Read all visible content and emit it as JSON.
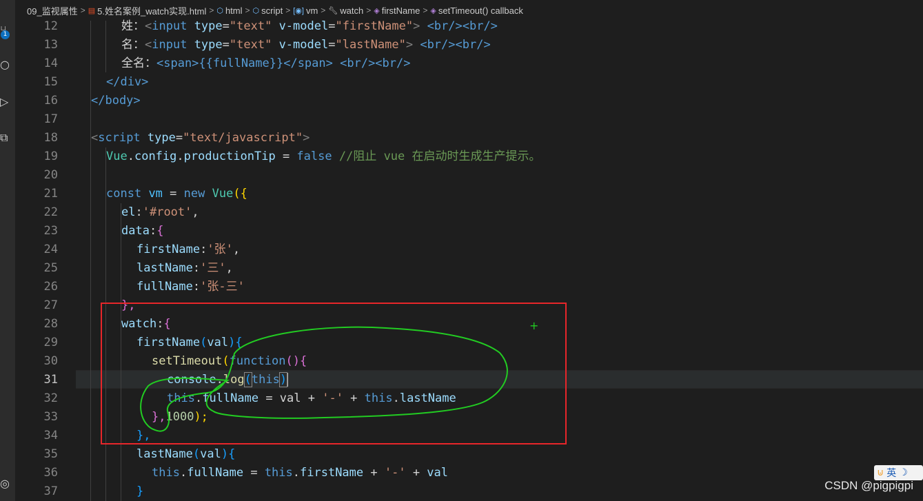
{
  "breadcrumb": {
    "folder": "09_监视属性",
    "file": "5.姓名案例_watch实现.html",
    "items": [
      "html",
      "script",
      "vm",
      "watch",
      "firstName",
      "setTimeout() callback"
    ]
  },
  "activity": {
    "badge_count": "1"
  },
  "gutter": {
    "line_numbers": [
      "12",
      "13",
      "14",
      "15",
      "16",
      "17",
      "18",
      "19",
      "20",
      "21",
      "22",
      "23",
      "24",
      "25",
      "26",
      "27",
      "28",
      "29",
      "30",
      "31",
      "32",
      "33",
      "34",
      "35",
      "36",
      "37"
    ],
    "active_line": "31"
  },
  "code": {
    "l12": {
      "label": "姓：",
      "tag_open": "<",
      "tag": "input",
      "a1": "type",
      "v1": "\"text\"",
      "a2": "v-model",
      "v2": "\"firstName\"",
      "br": "<br/><br/>"
    },
    "l13": {
      "label": "名：",
      "tag_open": "<",
      "tag": "input",
      "a1": "type",
      "v1": "\"text\"",
      "a2": "v-model",
      "v2": "\"lastName\"",
      "br": "<br/><br/>"
    },
    "l14": {
      "label": "全名：",
      "text": "<span>{{fullName}}</span>",
      "br": "<br/><br/>"
    },
    "l15": "</div>",
    "l16": "</body>",
    "l18": {
      "tag": "script",
      "attr": "type",
      "val": "\"text/javascript\""
    },
    "l19": {
      "obj": "Vue",
      "p1": "config",
      "p2": "productionTip",
      "eq": " = ",
      "val": "false",
      "comment": "//阻止 vue 在启动时生成生产提示。"
    },
    "l21": {
      "kw1": "const",
      "name": "vm",
      "eq": " = ",
      "kw2": "new",
      "cls": "Vue",
      "open": "({"
    },
    "l22": {
      "key": "el",
      "val": "'#root'"
    },
    "l23": {
      "key": "data"
    },
    "l24": {
      "key": "firstName",
      "val": "'张'"
    },
    "l25": {
      "key": "lastName",
      "val": "'三'"
    },
    "l26": {
      "key": "fullName",
      "val": "'张-三'"
    },
    "l27": "},",
    "l28": {
      "key": "watch"
    },
    "l29": {
      "fn": "firstName",
      "param": "val"
    },
    "l30": {
      "fn": "setTimeout",
      "kw": "function"
    },
    "l31": {
      "obj": "console",
      "fn": "log",
      "arg": "this"
    },
    "l32": {
      "this1": "this",
      "p1": "fullName",
      "rest": " = val + ",
      "sep": "'-'",
      "plus": " + ",
      "this2": "this",
      "p2": "lastName"
    },
    "l33": {
      "close": "},",
      "num": "1000",
      "end": ");"
    },
    "l34": "},",
    "l35": {
      "fn": "lastName",
      "param": "val"
    },
    "l36": {
      "this1": "this",
      "p1": "fullName",
      "eq": " = ",
      "this2": "this",
      "p2": "firstName",
      "plus": " + ",
      "sep": "'-'",
      "plus2": " + ",
      "v": "val"
    },
    "l37": "}"
  },
  "ime": {
    "label": "英"
  },
  "watermark": "CSDN @pigpigpi",
  "colors": {
    "editor_bg": "#1e1e1e",
    "annotation_red": "#e8262a",
    "annotation_green": "#22cc22"
  }
}
